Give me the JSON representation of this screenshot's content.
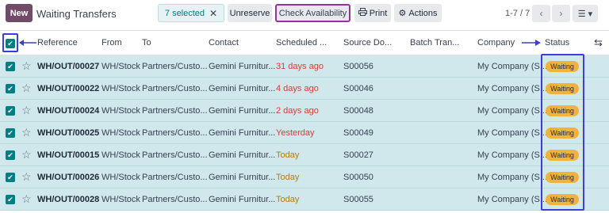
{
  "header": {
    "new_label": "New",
    "title": "Waiting Transfers",
    "selected_label": "7 selected",
    "unreserve_label": "Unreserve",
    "check_availability_label": "Check Availability",
    "print_label": "Print",
    "actions_label": "Actions",
    "pager": "1-7 / 7",
    "accent_color": "#714B67"
  },
  "columns": [
    "Reference",
    "From",
    "To",
    "Contact",
    "Scheduled ...",
    "Source Do...",
    "Batch Tran...",
    "Company",
    "Status"
  ],
  "rows": [
    {
      "reference": "WH/OUT/00027",
      "from": "WH/Stock",
      "to": "Partners/Custo...",
      "contact": "Gemini Furnitur...",
      "scheduled": "31 days ago",
      "source": "S00056",
      "company": "My Company (S...",
      "status": "Waiting"
    },
    {
      "reference": "WH/OUT/00022",
      "from": "WH/Stock",
      "to": "Partners/Custo...",
      "contact": "Gemini Furnitur...",
      "scheduled": "4 days ago",
      "source": "S00046",
      "company": "My Company (S...",
      "status": "Waiting"
    },
    {
      "reference": "WH/OUT/00024",
      "from": "WH/Stock",
      "to": "Partners/Custo...",
      "contact": "Gemini Furnitur...",
      "scheduled": "2 days ago",
      "source": "S00048",
      "company": "My Company (S...",
      "status": "Waiting"
    },
    {
      "reference": "WH/OUT/00025",
      "from": "WH/Stock",
      "to": "Partners/Custo...",
      "contact": "Gemini Furnitur...",
      "scheduled": "Yesterday",
      "source": "S00049",
      "company": "My Company (S...",
      "status": "Waiting"
    },
    {
      "reference": "WH/OUT/00015",
      "from": "WH/Stock",
      "to": "Partners/Custo...",
      "contact": "Gemini Furnitur...",
      "scheduled": "Today",
      "source": "S00027",
      "company": "My Company (S...",
      "status": "Waiting"
    },
    {
      "reference": "WH/OUT/00026",
      "from": "WH/Stock",
      "to": "Partners/Custo...",
      "contact": "Gemini Furnitur...",
      "scheduled": "Today",
      "source": "S00050",
      "company": "My Company (S...",
      "status": "Waiting"
    },
    {
      "reference": "WH/OUT/00028",
      "from": "WH/Stock",
      "to": "Partners/Custo...",
      "contact": "Gemini Furnitur...",
      "scheduled": "Today",
      "source": "S00055",
      "company": "My Company (S...",
      "status": "Waiting"
    }
  ],
  "colors": {
    "row_selected_bg": "#d0e7eb",
    "overdue": "#d23f3a",
    "today": "#b07f18",
    "status_badge": "#f2b33a",
    "annotation": "#3b3fd6",
    "annotation_highlight": "#9c2fa0"
  }
}
